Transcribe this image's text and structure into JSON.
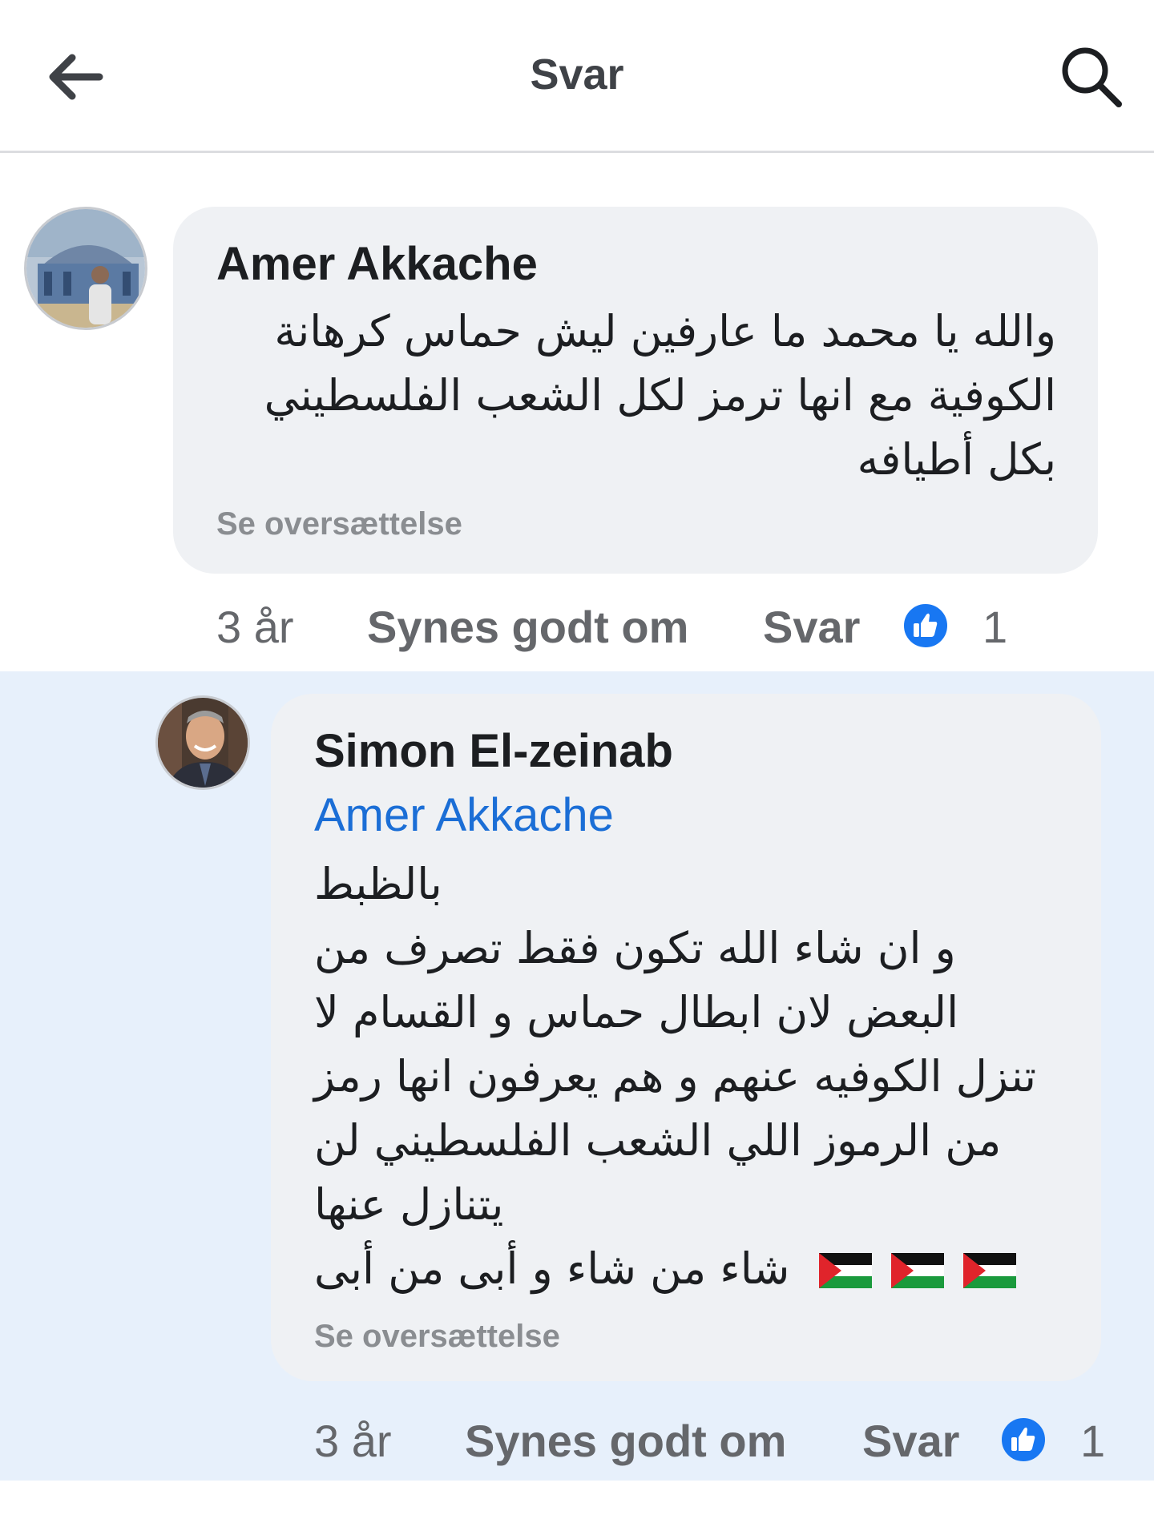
{
  "header": {
    "title": "Svar",
    "back_icon": "back-arrow-icon",
    "search_icon": "search-icon"
  },
  "comment": {
    "author": "Amer Akkache",
    "lines": [
      "والله يا محمد ما عارفين ليش حماس كرهانة",
      "الكوفية مع انها ترمز لكل الشعب الفلسطيني",
      "بكل أطيافه"
    ],
    "translate": "Se oversættelse",
    "time": "3 år",
    "like_label": "Synes godt om",
    "reply_label": "Svar",
    "reaction_count": "1"
  },
  "reply": {
    "author": "Simon El-zeinab",
    "mention": "Amer Akkache",
    "lines": [
      "بالظبط",
      "و ان شاء الله تكون فقط تصرف من",
      "البعض لان ابطال حماس و القسام لا",
      "تنزل الكوفيه عنهم و هم يعرفون انها رمز",
      "من الرموز اللي الشعب الفلسطيني لن",
      "يتنازل عنها",
      "شاء من شاء و أبى من أبى"
    ],
    "flags": "palestine-flag-emoji",
    "translate": "Se oversættelse",
    "time": "3 år",
    "like_label": "Synes godt om",
    "reply_label": "Svar",
    "reaction_count": "1"
  },
  "colors": {
    "link_blue": "#1b6ed6",
    "like_blue": "#1877f2",
    "bubble_gray": "#eff1f4",
    "highlight_bg": "#e7f0fb"
  }
}
